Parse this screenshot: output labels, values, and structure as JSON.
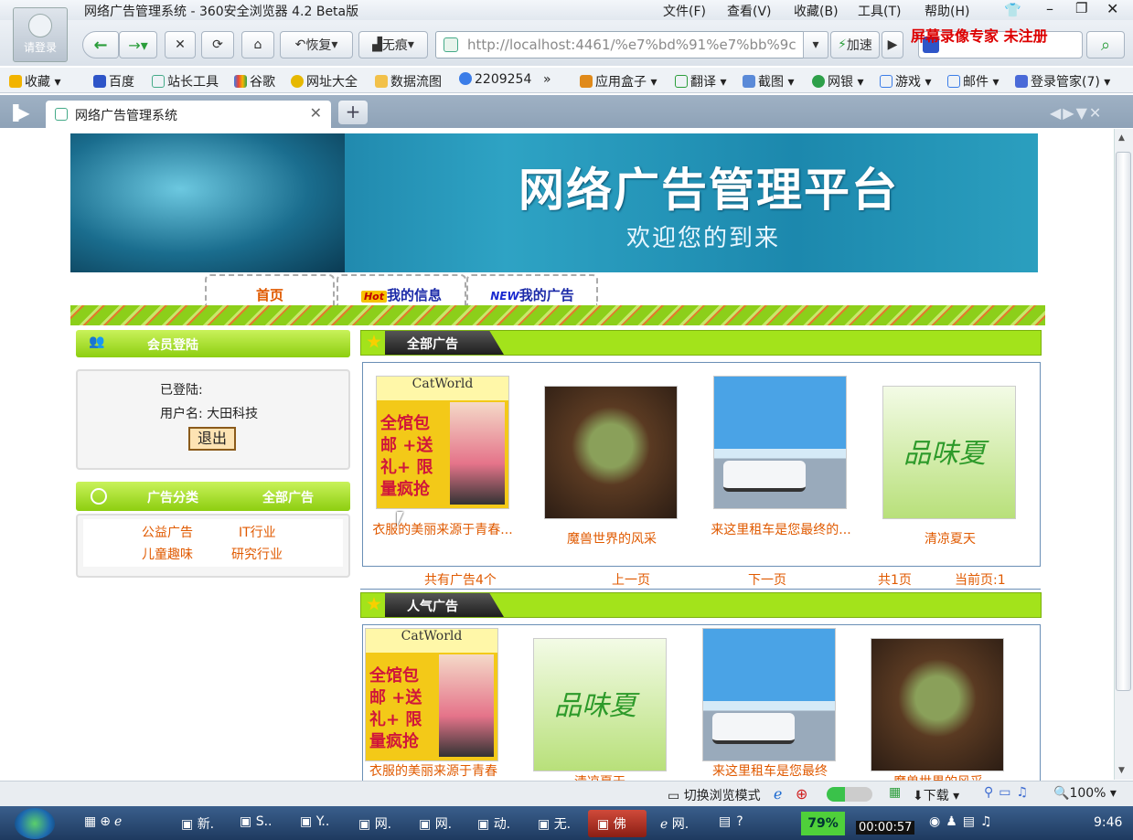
{
  "browser": {
    "window_title": "网络广告管理系统 - 360安全浏览器 4.2 Beta版",
    "menus": [
      "文件(F)",
      "查看(V)",
      "收藏(B)",
      "工具(T)",
      "帮助(H)"
    ],
    "avatar_label": "请登录",
    "toolbar": {
      "restore": "恢复",
      "incognito": "无痕",
      "speedup": "加速"
    },
    "address": "http://localhost:4461/%e7%bd%91%e7%bb%9c",
    "recorder_watermark": "屏幕录像专家  未注册",
    "bookmarks": [
      "收藏",
      "百度",
      "站长工具",
      "谷歌",
      "网址大全",
      "数据流图",
      "2209254",
      "»",
      "应用盒子",
      "翻译",
      "截图",
      "网银",
      "游戏",
      "邮件",
      "登录管家(7)"
    ],
    "tab_title": "网络广告管理系统"
  },
  "page": {
    "banner_title": "网络广告管理平台",
    "banner_subtitle": "欢迎您的到来",
    "nav": {
      "home": "首页",
      "hot_badge": "Hot",
      "my_info": "我的信息",
      "new_badge": "NEW",
      "my_ads": "我的广告"
    },
    "login": {
      "header": "会员登陆",
      "status_label": "已登陆:",
      "username_label": "用户名: 大田科技",
      "logout": "退出"
    },
    "category": {
      "header": "广告分类",
      "all_link": "全部广告",
      "items": [
        "公益广告",
        "IT行业",
        "儿童趣味",
        "研究行业"
      ]
    },
    "all_ads": {
      "header": "全部广告",
      "items": [
        {
          "caption": "衣服的美丽来源于青春...",
          "image": "catworld-clothing-ad"
        },
        {
          "caption": "魔兽世界的风采",
          "image": "warcraft-orc-ad"
        },
        {
          "caption": "来这里租车是您最终的...",
          "image": "bus-rental-ad"
        },
        {
          "caption": "清凉夏天",
          "image": "summer-green-ad"
        }
      ],
      "pager": {
        "total": "共有广告4个",
        "prev": "上一页",
        "next": "下一页",
        "pages": "共1页",
        "current": "当前页:1"
      }
    },
    "popular_ads": {
      "header": "人气广告",
      "items": [
        {
          "caption": "衣服的美丽来源于青春",
          "image": "catworld-clothing-ad"
        },
        {
          "caption": "清凉夏天",
          "image": "summer-green-ad"
        },
        {
          "caption": "来这里租车是您最终",
          "image": "bus-rental-ad"
        },
        {
          "caption": "魔兽世界的风采",
          "image": "warcraft-orc-ad"
        }
      ]
    },
    "ad_image_text": {
      "catworld": "CatWorld",
      "cat_slogan": "全馆包邮 +送礼+ 限量疯抢"
    }
  },
  "status_bar": {
    "mode": "切换浏览模式",
    "download": "下载",
    "zoom": "100%"
  },
  "taskbar": {
    "items": [
      "新.",
      "S..",
      "Y..",
      "网.",
      "网.",
      "动.",
      "无.",
      "佛",
      "网."
    ],
    "battery": "79%",
    "timer": "00:00:57",
    "clock": "9:46"
  }
}
